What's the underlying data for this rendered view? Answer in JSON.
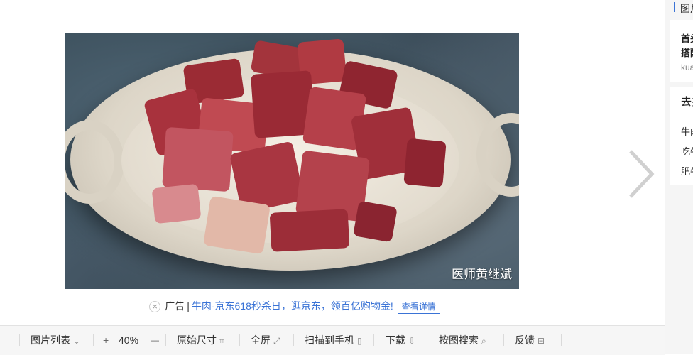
{
  "photo": {
    "watermark": "医师黄继斌",
    "alt": "牛肉"
  },
  "ad": {
    "close_icon": "close-icon",
    "tag": "广告",
    "separator": "|",
    "text": "牛肉-京东618秒杀日，逛京东，领百亿购物金!",
    "button": "查看详情"
  },
  "toolbar": {
    "image_list": "图片列表",
    "zoom_in": "+",
    "zoom_level": "40%",
    "zoom_out": "—",
    "original_size": "原始尺寸",
    "fullscreen": "全屏",
    "scan_to_phone": "扫描到手机",
    "download": "下载",
    "search_by_image": "按图搜索",
    "feedback": "反馈"
  },
  "sidebar": {
    "header": "图片",
    "card1_line1": "首头",
    "card1_line2": "搭配",
    "card1_source": "kua",
    "card2_title": "去找",
    "list": [
      "牛肉",
      "吃牛",
      "肥牛"
    ]
  },
  "colors": {
    "link": "#3a73d6",
    "accent_bar": "#3a73d6",
    "toolbar_bg": "#f6f6f6"
  }
}
